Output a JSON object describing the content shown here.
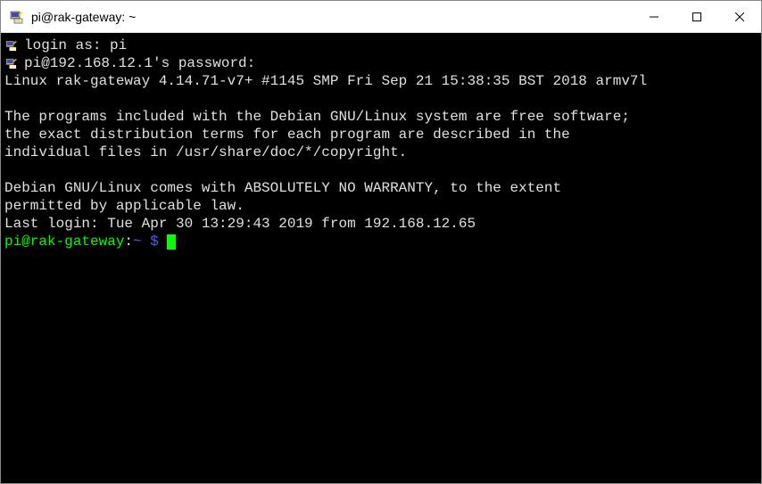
{
  "window": {
    "title": "pi@rak-gateway: ~"
  },
  "terminal": {
    "login_prompt": "login as: pi",
    "password_prompt": "pi@192.168.12.1's password:",
    "system_info": "Linux rak-gateway 4.14.71-v7+ #1145 SMP Fri Sep 21 15:38:35 BST 2018 armv7l",
    "motd_line1": "The programs included with the Debian GNU/Linux system are free software;",
    "motd_line2": "the exact distribution terms for each program are described in the",
    "motd_line3": "individual files in /usr/share/doc/*/copyright.",
    "motd_line4": "Debian GNU/Linux comes with ABSOLUTELY NO WARRANTY, to the extent",
    "motd_line5": "permitted by applicable law.",
    "last_login": "Last login: Tue Apr 30 13:29:43 2019 from 192.168.12.65",
    "prompt_user_host": "pi@rak-gateway",
    "prompt_colon": ":",
    "prompt_path": "~ $",
    "prompt_space": " "
  }
}
